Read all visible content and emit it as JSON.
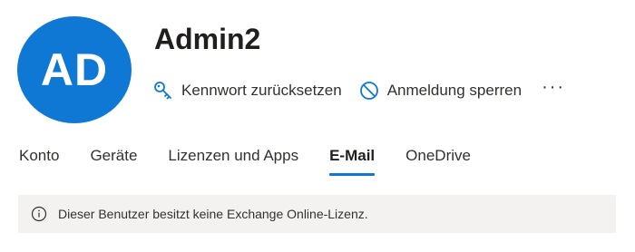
{
  "user": {
    "initials": "AD",
    "name": "Admin2",
    "avatar_color": "#0f78d4"
  },
  "actions": {
    "reset_password": {
      "label": "Kennwort zurücksetzen",
      "icon": "key-icon"
    },
    "block_signin": {
      "label": "Anmeldung sperren",
      "icon": "block-icon"
    },
    "more": {
      "label": "···",
      "icon": "more-icon"
    }
  },
  "tabs": [
    {
      "label": "Konto",
      "active": false
    },
    {
      "label": "Geräte",
      "active": false
    },
    {
      "label": "Lizenzen und Apps",
      "active": false
    },
    {
      "label": "E-Mail",
      "active": true
    },
    {
      "label": "OneDrive",
      "active": false
    }
  ],
  "banner": {
    "icon": "info-icon",
    "message": "Dieser Benutzer besitzt keine Exchange Online-Lizenz."
  },
  "colors": {
    "accent": "#0f78d4",
    "banner_bg": "#f3f2f1",
    "text": "#323130"
  }
}
